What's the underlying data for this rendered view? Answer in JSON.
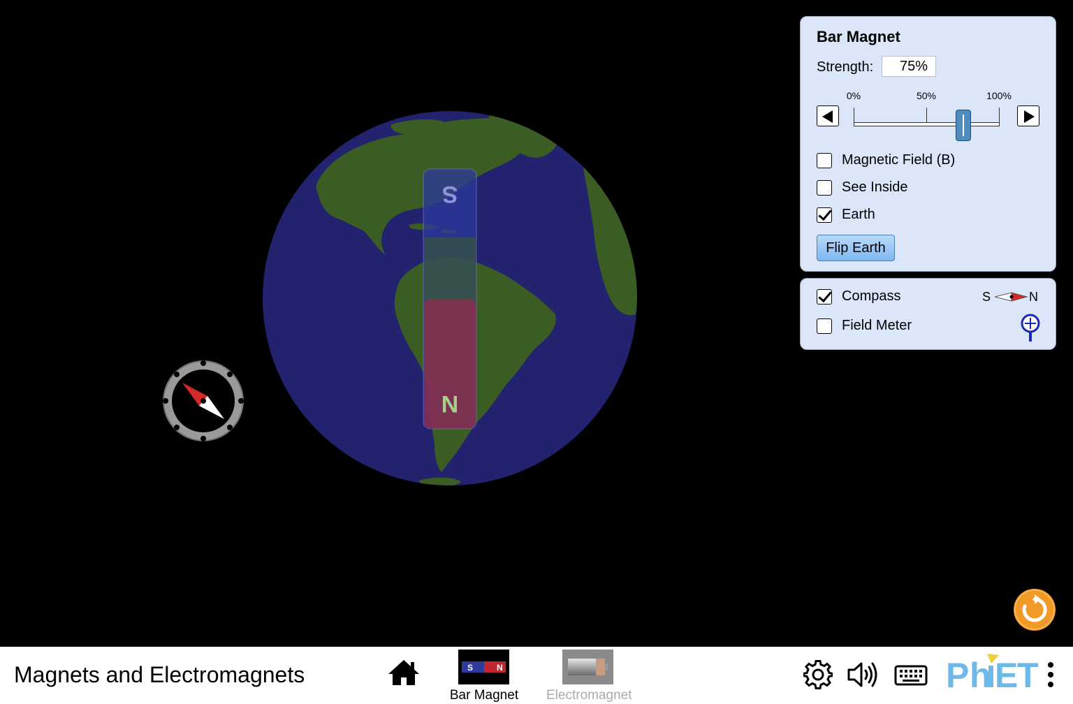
{
  "sim": {
    "title": "Magnets and Electromagnets"
  },
  "bar_magnet_panel": {
    "title": "Bar Magnet",
    "strength_label": "Strength:",
    "strength_value": "75%",
    "strength_fraction": 0.75,
    "slider_ticks": [
      "0%",
      "50%",
      "100%"
    ],
    "checkboxes": {
      "magnetic_field": {
        "label": "Magnetic Field (B)",
        "checked": false
      },
      "see_inside": {
        "label": "See Inside",
        "checked": false
      },
      "earth": {
        "label": "Earth",
        "checked": true
      }
    },
    "flip_earth_label": "Flip Earth"
  },
  "tools_panel": {
    "compass": {
      "label": "Compass",
      "checked": true
    },
    "field_meter": {
      "label": "Field Meter",
      "checked": false
    },
    "compass_icon_s": "S",
    "compass_icon_n": "N"
  },
  "play_area": {
    "magnet_top_pole": "S",
    "magnet_bottom_pole": "N"
  },
  "navbar": {
    "screens": [
      {
        "label": "Bar Magnet",
        "selected": true,
        "thumb_s": "S",
        "thumb_n": "N"
      },
      {
        "label": "Electromagnet",
        "selected": false
      }
    ]
  },
  "colors": {
    "ocean": "#22226e",
    "land": "#3b5d24",
    "magnet_north_red": "#c0272d",
    "magnet_south_blue": "#2e3a9c",
    "panel_bg": "#dbe6f9",
    "button_blue": "#8cc0f2",
    "reset_orange": "#f19a27",
    "phet_blue": "#6fb9e9",
    "phet_yellow": "#f0d040"
  }
}
